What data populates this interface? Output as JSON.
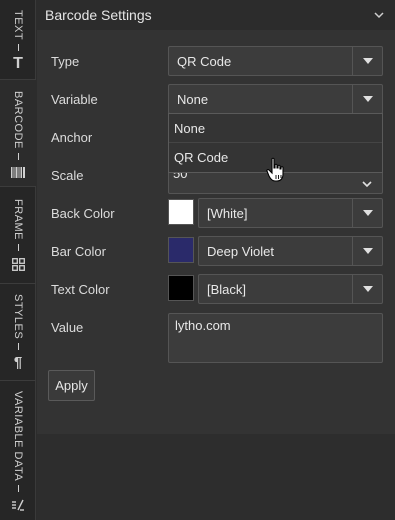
{
  "rail": {
    "tabs": [
      {
        "label": "TEXT",
        "icon": "text-icon"
      },
      {
        "label": "BARCODE",
        "icon": "barcode-icon"
      },
      {
        "label": "FRAME",
        "icon": "grid-icon"
      },
      {
        "label": "STYLES",
        "icon": "pilcrow-icon"
      },
      {
        "label": "VARIABLE DATA",
        "icon": "variable-icon"
      }
    ]
  },
  "header": {
    "title": "Barcode Settings"
  },
  "fields": {
    "type": {
      "label": "Type",
      "value": "QR Code"
    },
    "variable": {
      "label": "Variable",
      "value": "None"
    },
    "anchor": {
      "label": "Anchor"
    },
    "scale": {
      "label": "Scale",
      "value": "50"
    },
    "back_color": {
      "label": "Back Color",
      "value": "[White]",
      "swatch": "#ffffff"
    },
    "bar_color": {
      "label": "Bar Color",
      "value": "Deep Violet",
      "swatch": "#2a2a6a"
    },
    "text_color": {
      "label": "Text Color",
      "value": "[Black]",
      "swatch": "#000000"
    },
    "value": {
      "label": "Value",
      "text": "lytho.com"
    }
  },
  "dropdown": {
    "options": [
      "None",
      "QR Code"
    ]
  },
  "apply_label": "Apply"
}
